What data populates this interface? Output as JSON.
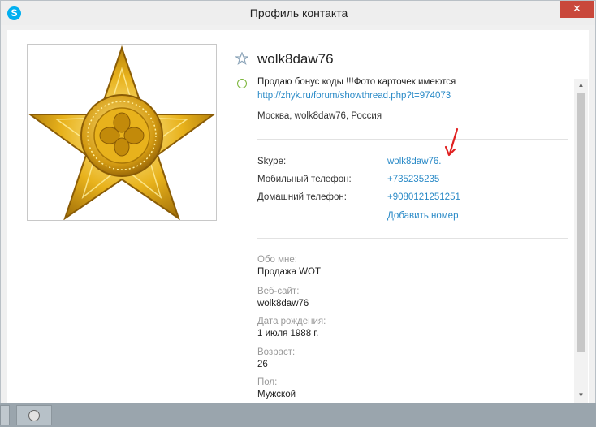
{
  "window": {
    "title": "Профиль контакта",
    "app_icon": "skype-logo-icon",
    "close_label": "✕"
  },
  "profile": {
    "display_name": "wolk8daw76",
    "favorite_icon": "star-outline-icon",
    "status_icon": "online-status-icon",
    "mood_text": "Продаю бонус коды !!!Фото карточек имеются",
    "mood_link": "http://zhyk.ru/forum/showthread.php?t=974073",
    "location": "Москва, wolk8daw76, Россия"
  },
  "contacts": {
    "skype_label": "Skype:",
    "skype_value": "wolk8daw76.",
    "mobile_label": "Мобильный телефон:",
    "mobile_value": "+735235235",
    "home_label": "Домашний телефон:",
    "home_value": "+9080121251251",
    "add_number": "Добавить номер"
  },
  "details": {
    "about_label": "Обо мне:",
    "about_value": "Продажа WOT",
    "website_label": "Веб-сайт:",
    "website_value": "wolk8daw76",
    "birthdate_label": "Дата рождения:",
    "birthdate_value": "1 июля 1988 г.",
    "age_label": "Возраст:",
    "age_value": "26",
    "gender_label": "Пол:",
    "gender_value": "Мужской"
  },
  "colors": {
    "link": "#2a8ac7",
    "close": "#c9483b",
    "online": "#7ab538",
    "annotation": "#e02020"
  }
}
